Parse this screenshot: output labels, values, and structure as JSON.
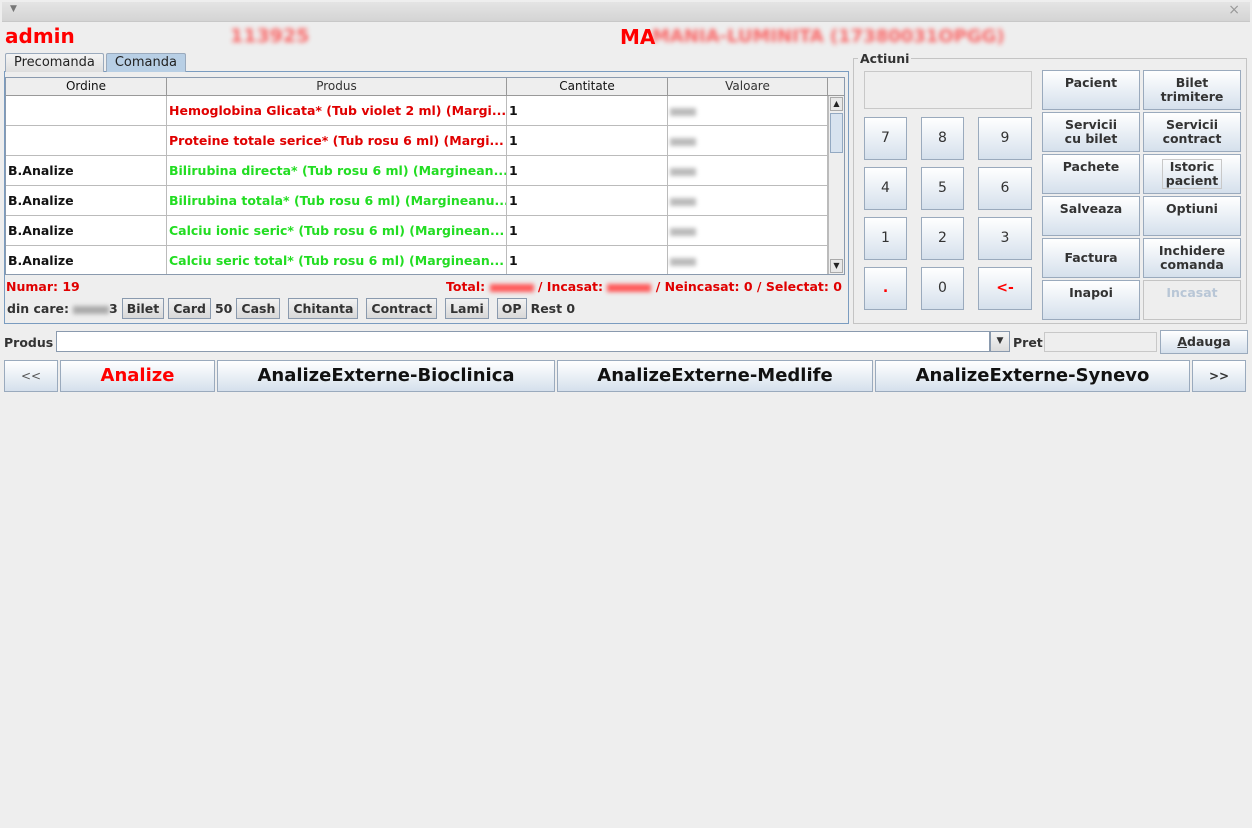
{
  "header": {
    "user": "admin",
    "id_blurred": "113925",
    "patient_prefix": "MA",
    "patient_blurred": "MANIA-LUMINITA (17380031OPGG)"
  },
  "tabs": [
    {
      "label": "Precomanda"
    },
    {
      "label": "Comanda"
    }
  ],
  "table": {
    "columns": [
      "Ordine",
      "Produs",
      "Cantitate",
      "Valoare"
    ],
    "rows": [
      {
        "ordine": "",
        "produs": "Hemoglobina Glicata* (Tub violet 2 ml) (Margi...",
        "cantitate": "1",
        "color": "red"
      },
      {
        "ordine": "",
        "produs": "Proteine totale serice* (Tub rosu 6 ml) (Margi...",
        "cantitate": "1",
        "color": "red"
      },
      {
        "ordine": "B.Analize",
        "produs": "Bilirubina directa* (Tub rosu 6 ml) (Marginean...",
        "cantitate": "1",
        "color": "green"
      },
      {
        "ordine": "B.Analize",
        "produs": "Bilirubina totala* (Tub rosu 6 ml) (Margineanu...",
        "cantitate": "1",
        "color": "green"
      },
      {
        "ordine": "B.Analize",
        "produs": "Calciu ionic seric* (Tub rosu 6 ml) (Marginean...",
        "cantitate": "1",
        "color": "green"
      },
      {
        "ordine": "B.Analize",
        "produs": "Calciu seric total* (Tub rosu 6 ml) (Marginean...",
        "cantitate": "1",
        "color": "green"
      }
    ]
  },
  "summary": {
    "numar": "Numar: 19",
    "total_label": "Total:",
    "incasat_label": "/ Incasat:",
    "neincasat": "/ Neincasat: 0",
    "selectat": "/ Selectat: 0"
  },
  "payment": {
    "din_care": "din care:",
    "suffix_3": "3",
    "bilet": "Bilet",
    "card": "Card",
    "card_value": "50",
    "cash": "Cash",
    "chitanta": "Chitanta",
    "contract": "Contract",
    "lami": "Lami",
    "op": "OP",
    "rest": "Rest 0"
  },
  "actions": {
    "title": "Actiuni",
    "keys": [
      "7",
      "8",
      "9",
      "4",
      "5",
      "6",
      "1",
      "2",
      "3",
      ".",
      "0",
      "<-"
    ],
    "buttons": {
      "pacient": "Pacient",
      "bilet_trimitere_1": "Bilet",
      "bilet_trimitere_2": "trimitere",
      "servicii_bilet_1": "Servicii",
      "servicii_bilet_2": "cu bilet",
      "servicii_contract_1": "Servicii",
      "servicii_contract_2": "contract",
      "pachete": "Pachete",
      "istoric_1": "Istoric",
      "istoric_2": "pacient",
      "salveaza": "Salveaza",
      "optiuni": "Optiuni",
      "factura": "Factura",
      "inchidere_1": "Inchidere",
      "inchidere_2": "comanda",
      "inapoi": "Inapoi",
      "incasat": "Incasat"
    }
  },
  "produs": {
    "label": "Produs",
    "value": "",
    "pret_label": "Pret",
    "pret_value": "",
    "adauga_first": "A",
    "adauga_rest": "dauga"
  },
  "categories": {
    "prev": "<<",
    "next": ">>",
    "items": [
      "Analize",
      "AnalizeExterne-Bioclinica",
      "AnalizeExterne-Medlife",
      "AnalizeExterne-Synevo"
    ]
  },
  "colors": {
    "accent_red": "#ff0000",
    "ok_green": "#22dd22",
    "button_gradient_end": "#d5e0ec"
  }
}
